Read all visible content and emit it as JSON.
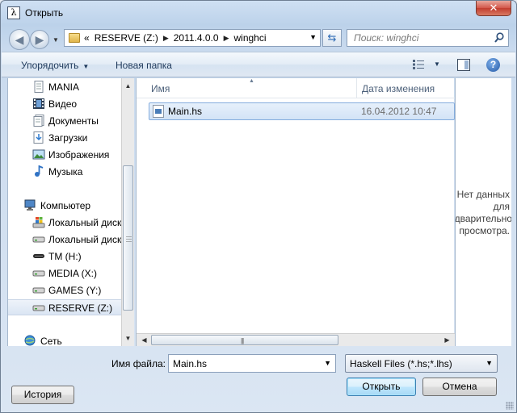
{
  "window": {
    "title": "Открыть",
    "close_glyph": "✕",
    "app_icon_glyph": "λ"
  },
  "address": {
    "crumbs": [
      "RESERVE (Z:)",
      "2011.4.0.0",
      "winghci"
    ],
    "overflow": "«"
  },
  "search": {
    "placeholder": "Поиск: winghci"
  },
  "toolbar": {
    "organize": "Упорядочить",
    "new_folder": "Новая папка",
    "help": "?"
  },
  "nav": {
    "items": [
      {
        "label": "MANIA",
        "icon": "document-icon"
      },
      {
        "label": "Видео",
        "icon": "video-icon"
      },
      {
        "label": "Документы",
        "icon": "documents-icon"
      },
      {
        "label": "Загрузки",
        "icon": "downloads-icon"
      },
      {
        "label": "Изображения",
        "icon": "pictures-icon"
      },
      {
        "label": "Музыка",
        "icon": "music-icon"
      },
      {
        "label": "Компьютер",
        "icon": "computer-icon"
      },
      {
        "label": "Локальный диск",
        "icon": "windows-drive-icon"
      },
      {
        "label": "Локальный диск",
        "icon": "drive-icon"
      },
      {
        "label": "TM (H:)",
        "icon": "removable-drive-icon"
      },
      {
        "label": "MEDIA (X:)",
        "icon": "drive-icon"
      },
      {
        "label": "GAMES (Y:)",
        "icon": "drive-icon"
      },
      {
        "label": "RESERVE (Z:)",
        "icon": "drive-icon",
        "selected": true
      },
      {
        "label": "Сеть",
        "icon": "network-icon"
      }
    ]
  },
  "files": {
    "columns": {
      "name": "Имя",
      "date": "Дата изменения"
    },
    "rows": [
      {
        "name": "Main.hs",
        "date": "16.04.2012 10:47",
        "selected": true
      }
    ]
  },
  "preview": {
    "text": "Нет данных для предварительного просмотра."
  },
  "bottom": {
    "filename_label": "Имя файла:",
    "filename_value": "Main.hs",
    "filter": "Haskell Files (*.hs;*.lhs)",
    "open": "Открыть",
    "cancel": "Отмена",
    "history": "История"
  }
}
